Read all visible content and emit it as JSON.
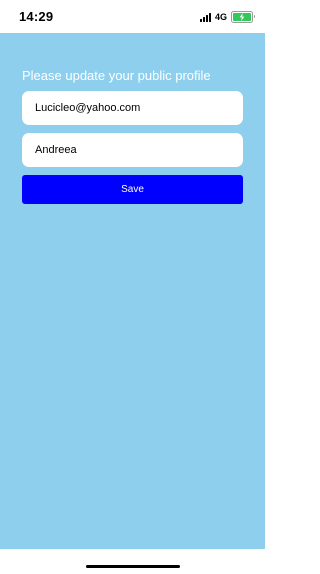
{
  "status_bar": {
    "time": "14:29",
    "network": "4G",
    "signal_bars": 4,
    "battery_level": 1.0,
    "battery_charging": true,
    "battery_color": "#34c759"
  },
  "screen": {
    "heading": "Please update your public profile",
    "background_color": "#8ecfee",
    "email_value": "Lucicleo@yahoo.com",
    "name_value": "Andreea",
    "save_label": "Save",
    "save_color": "#0000ff"
  },
  "icons": {
    "signal": "signal-bars-icon",
    "battery": "battery-charging-icon"
  }
}
